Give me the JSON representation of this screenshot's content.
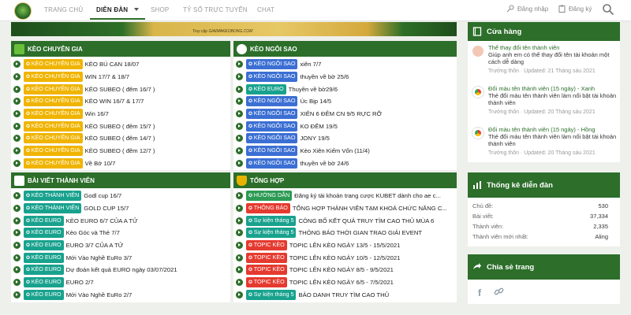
{
  "nav": {
    "items": [
      "TRANG CHỦ",
      "DIỄN ĐÀN",
      "SHOP",
      "TỶ SỐ TRỰC TUYẾN",
      "CHAT"
    ],
    "login": "Đăng nhập",
    "register": "Đăng ký"
  },
  "banner": {
    "text": "Truy cập GIAIMAKEOBONG.COM"
  },
  "panels": {
    "keo_chuyen_gia": {
      "title": "KÈO CHUYÊN GIA",
      "rows": [
        {
          "badge": "KÈO CHUYÊN GIA",
          "text": "KÈO BÚ CẠN 18/07"
        },
        {
          "badge": "KÈO CHUYÊN GIA",
          "text": "WIN 17/7 & 18/7"
        },
        {
          "badge": "KÈO CHUYÊN GIA",
          "text": "KÈO SUBEO ( đêm 16/7 )"
        },
        {
          "badge": "KÈO CHUYÊN GIA",
          "text": "KÈO WIN 16/7 & 17/7"
        },
        {
          "badge": "KÈO CHUYÊN GIA",
          "text": "Win 16/7"
        },
        {
          "badge": "KÈO CHUYÊN GIA",
          "text": "KÈO SUBEO ( đêm 15/7 )"
        },
        {
          "badge": "KÈO CHUYÊN GIA",
          "text": "KÈO SUBEO ( đêm 14/7 )"
        },
        {
          "badge": "KÈO CHUYÊN GIA",
          "text": "KÈO SUBEO ( đêm 12/7 )"
        },
        {
          "badge": "KÈO CHUYÊN GIA",
          "text": "Về Bờ 10/7"
        }
      ]
    },
    "keo_ngoi_sao": {
      "title": "KÈO NGÔI SAO",
      "rows": [
        {
          "badge": "KÈO NGÔI SAO",
          "text": "xiên 7/7",
          "color": "blue"
        },
        {
          "badge": "KÈO NGÔI SAO",
          "text": "thuyền về bờ 25/6",
          "color": "blue"
        },
        {
          "badge": "KÈO EURO",
          "text": "Thuyền về bờ29/6",
          "color": "teal"
        },
        {
          "badge": "KÈO NGÔI SAO",
          "text": "Úc Bịp 14/5",
          "color": "blue"
        },
        {
          "badge": "KÈO NGÔI SAO",
          "text": "XIÊN 6 ĐÊM CN 9/5 RỰC RỠ",
          "color": "blue"
        },
        {
          "badge": "KÈO NGÔI SAO",
          "text": "KO ĐÊM 19/5",
          "color": "blue"
        },
        {
          "badge": "KÈO NGÔI SAO",
          "text": "JONY 19/5",
          "color": "blue"
        },
        {
          "badge": "KÈO NGÔI SAO",
          "text": "Kèo Xiên Kiếm Vốn (11/4)",
          "color": "blue"
        },
        {
          "badge": "KÈO NGÔI SAO",
          "text": "thuyền về bờ 24/6",
          "color": "blue"
        }
      ]
    },
    "bai_viet": {
      "title": "BÀI VIẾT THÀNH VIÊN",
      "rows": [
        {
          "badge": "KÈO THÀNH VIÊN",
          "text": "Godl cup 16/7",
          "color": "teal"
        },
        {
          "badge": "KÈO THÀNH VIÊN",
          "text": "GOLD CUP 15/7",
          "color": "teal"
        },
        {
          "badge": "KÈO EURO",
          "text": "KÈO EURO 6/7 CỦA A TỬ",
          "color": "teal"
        },
        {
          "badge": "KÈO EURO",
          "text": "Kèo Góc và Thẻ 7/7",
          "color": "teal"
        },
        {
          "badge": "KÈO EURO",
          "text": "EURO 3/7 CỦA A TỬ",
          "color": "teal"
        },
        {
          "badge": "KÈO EURO",
          "text": "Mới Vào Nghề EuRo 3/7",
          "color": "teal"
        },
        {
          "badge": "KÈO EURO",
          "text": "Dự đoán kết quả EURO ngày 03/07/2021",
          "color": "teal"
        },
        {
          "badge": "KÈO EURO",
          "text": "EURO 2/7",
          "color": "teal"
        },
        {
          "badge": "KÈO EURO",
          "text": "Mới Vào Nghề EuRo 2/7",
          "color": "teal"
        }
      ]
    },
    "tong_hop": {
      "title": "TỔNG HỢP",
      "rows": [
        {
          "badge": "HƯỚNG DẪN",
          "text": "Đăng ký tài khoản trang cược KUBET dành cho ae c...",
          "color": "green"
        },
        {
          "badge": "THÔNG BÁO",
          "text": "TỔNG HỢP THÀNH VIÊN TẠM KHOÁ CHỨC NĂNG C...",
          "color": "red"
        },
        {
          "badge": "Sự kiện tháng 5",
          "text": "CÔNG BỐ KẾT QUẢ TRUY TÌM CAO THỦ MÙA 6",
          "color": "teal"
        },
        {
          "badge": "Sự kiện tháng 5",
          "text": "THÔNG BÁO THỜI GIAN TRAO GIẢI EVENT",
          "color": "teal"
        },
        {
          "badge": "TOPIC KÈO",
          "text": "TOPIC LÊN KÈO NGÀY 13/5 - 15/5/2021",
          "color": "red"
        },
        {
          "badge": "TOPIC KÈO",
          "text": "TOPIC LÊN KÈO NGÀY 10/5 - 12/5/2021",
          "color": "red"
        },
        {
          "badge": "TOPIC KÈO",
          "text": "TOPIC LÊN KÈO NGÀY 8/5 - 9/5/2021",
          "color": "red"
        },
        {
          "badge": "TOPIC KÈO",
          "text": "TOPIC LÊN KÈO NGÀY 6/5 - 7/5/2021",
          "color": "red"
        },
        {
          "badge": "Sự kiện tháng 5",
          "text": "BẢO DANH TRUY TÌM CAO THỦ",
          "color": "teal"
        }
      ]
    }
  },
  "sidebar": {
    "store": {
      "title": "Cửa hàng",
      "items": [
        {
          "title": "Thể thay đổi tên thành viên",
          "desc": "Giúp anh em có thể thay đổi tên tài khoản một cách dễ dàng",
          "meta": "Trưởng thôn · Updated: 21 Tháng sáu 2021"
        },
        {
          "title": "Đổi màu tên thành viên (15 ngày) - Xanh",
          "desc": "Thẻ đổi màu tên thành viên làm nổi bật tài khoản thành viên",
          "meta": "Trưởng thôn · Updated: 20 Tháng sáu 2021"
        },
        {
          "title": "Đổi màu tên thành viên (15 ngày) - Hồng",
          "desc": "Thẻ đổi màu tên thành viên làm nổi bật tài khoản thành viên",
          "meta": "Trưởng thôn · Updated: 20 Tháng sáu 2021"
        }
      ]
    },
    "stats": {
      "title": "Thống kê diễn đàn",
      "rows": [
        {
          "label": "Chủ đề:",
          "value": "530"
        },
        {
          "label": "Bài viết:",
          "value": "37,334"
        },
        {
          "label": "Thành viên:",
          "value": "2,335"
        },
        {
          "label": "Thành viên mới nhất:",
          "value": "Aling"
        }
      ]
    },
    "share": {
      "title": "Chia sẻ trang"
    }
  },
  "colors": {
    "brand": "#2c6e2a",
    "yellow": "#f0b400",
    "blue": "#3b6fd3",
    "teal": "#18a28e",
    "red": "#e53a2f",
    "green": "#2d9b53"
  },
  "icons": [
    "logo",
    "search-icon",
    "key-icon",
    "clipboard-icon",
    "soccer-icon",
    "star-ball-icon",
    "shoe-icon",
    "trophy-icon",
    "book-icon",
    "bar-chart-icon",
    "share-icon",
    "facebook-icon",
    "link-icon"
  ]
}
